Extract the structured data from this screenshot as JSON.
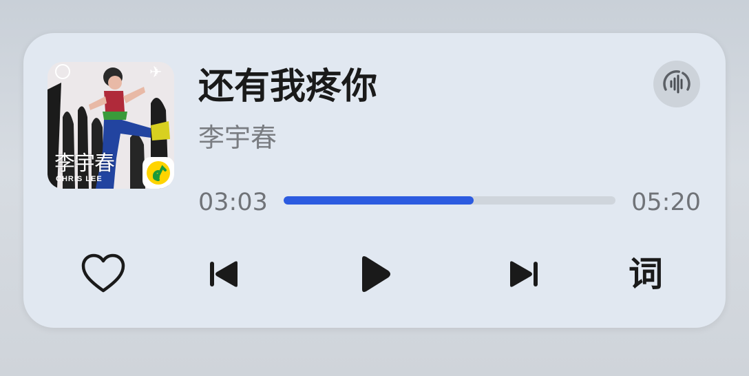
{
  "song": {
    "title": "还有我疼你",
    "artist": "李宇春"
  },
  "cover": {
    "title_text": "李宇春",
    "subtitle_text": "CHRIS LEE"
  },
  "playback": {
    "current_time": "03:03",
    "total_time": "05:20",
    "progress_fraction": 0.572
  },
  "controls": {
    "lyrics_label": "词"
  },
  "icons": [
    "heart-icon",
    "previous-icon",
    "play-icon",
    "next-icon",
    "voice-wave-icon",
    "qq-music-icon"
  ],
  "colors": {
    "progress": "#2c5be0",
    "card": "#e1e8f1",
    "app_badge": "#ffd400"
  }
}
